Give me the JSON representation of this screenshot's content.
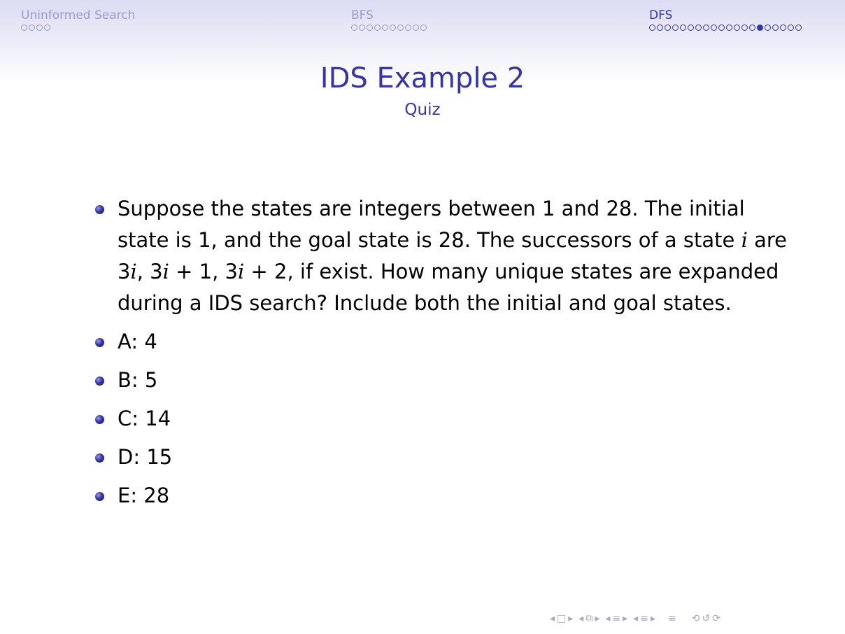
{
  "nav": {
    "sections": [
      {
        "title": "Uninformed Search",
        "dot_count": 4,
        "filled_index": -1,
        "active": false
      },
      {
        "title": "BFS",
        "dot_count": 10,
        "filled_index": -1,
        "active": false
      },
      {
        "title": "DFS",
        "dot_count": 20,
        "filled_index": 14,
        "active": true
      }
    ]
  },
  "slide": {
    "title": "IDS Example 2",
    "subtitle": "Quiz",
    "question": {
      "p1": "Suppose the states are integers between 1 and 28. The initial state is 1, and the goal state is 28. The successors of a state ",
      "var_i": "i",
      "p2": " are 3",
      "p3": ", 3",
      "p4": " + 1, 3",
      "p5": " + 2, if exist. How many unique states are expanded during a IDS search? Include both the initial and goal states."
    },
    "options": [
      "A: 4",
      "B: 5",
      "C: 14",
      "D: 15",
      "E: 28"
    ]
  },
  "controls": {
    "left_arrow": "◂",
    "right_arrow": "▸",
    "frame_icon": "□",
    "subsection_icon": "⧉",
    "section_icon": "≡",
    "align_icon": "≡",
    "search_icon": "↺",
    "back_icon": "⟲",
    "forward_icon": "⟳"
  },
  "colors": {
    "accent": "#3333b3",
    "dim": "#9a9ad2"
  }
}
